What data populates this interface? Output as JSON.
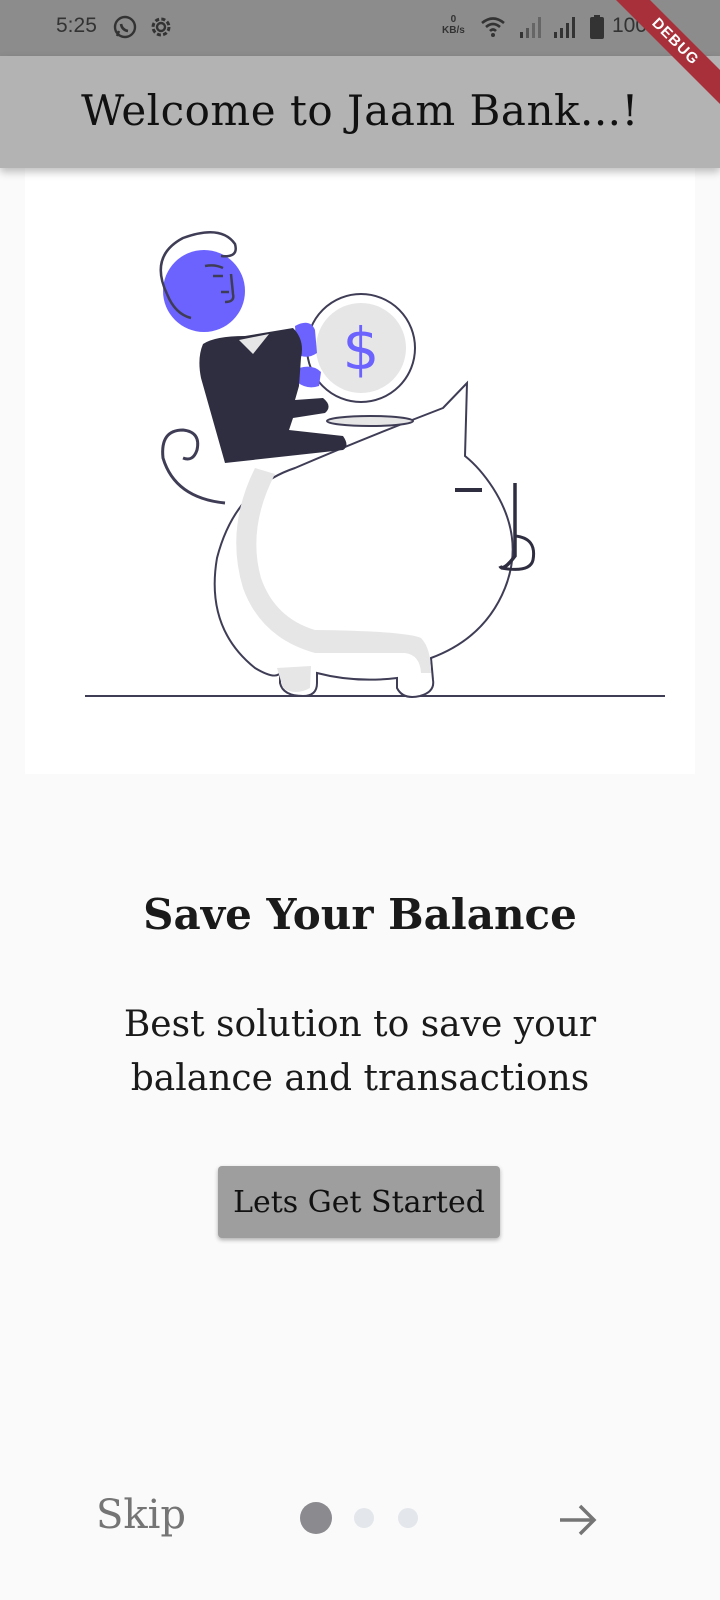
{
  "status_bar": {
    "time": "5:25",
    "speed_value": "0",
    "speed_unit": "KB/s",
    "battery": "100%",
    "icons": [
      "whatsapp-icon",
      "settings-gear-icon",
      "wifi-icon",
      "signal-icon",
      "signal-icon",
      "battery-icon"
    ]
  },
  "app_bar": {
    "title": "Welcome to Jaam Bank...!"
  },
  "debug_banner": {
    "label": "DEBUG",
    "color": "#a7303a"
  },
  "slide": {
    "illustration": "piggy-bank-coin-illustration",
    "title": "Save Your Balance",
    "description": "Best solution to save your balance and transactions",
    "cta_label": "Lets Get Started"
  },
  "pager": {
    "skip_label": "Skip",
    "page_count": 3,
    "current_page": 1,
    "next_icon": "arrow-right-icon"
  },
  "colors": {
    "accent": "#6c63ff",
    "dark": "#2f2e41",
    "app_bar": "#b3b3b3",
    "button": "#9e9e9e",
    "dot_active": "#8a8a8f",
    "dot_inactive": "#e3e6ea"
  }
}
